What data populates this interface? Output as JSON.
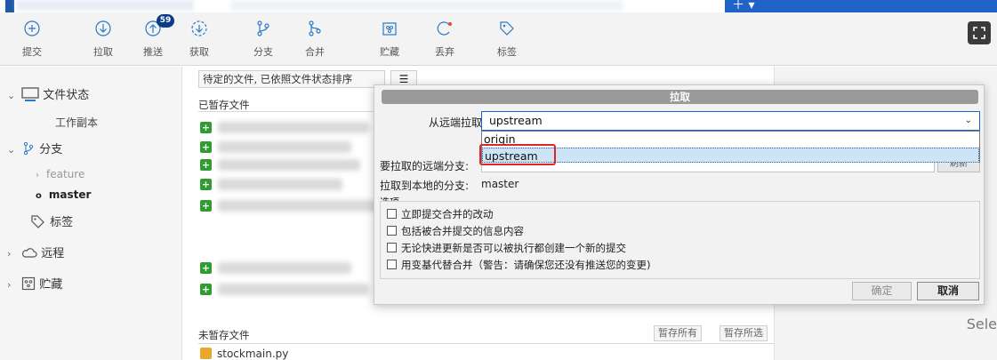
{
  "toolbar": {
    "commit": "提交",
    "pull": "拉取",
    "push": "推送",
    "push_badge": "59",
    "fetch": "获取",
    "branch": "分支",
    "merge": "合并",
    "stash": "贮藏",
    "discard": "丢弃",
    "tag": "标签"
  },
  "sidebar": {
    "file_status": "文件状态",
    "working_copy": "工作副本",
    "branches": "分支",
    "feature": "feature",
    "master": "master",
    "tags": "标签",
    "remotes": "远程",
    "stashes": "贮藏"
  },
  "main": {
    "sort_label": "待定的文件, 已依照文件状态排序",
    "view_label": "☰",
    "staged_title": "已暂存文件",
    "unstaged_title": "未暂存文件",
    "stage_all": "暂存所有",
    "stage_selected": "暂存所选",
    "file": "stockmain.py"
  },
  "right_panel": {
    "partial_text": "Sele"
  },
  "dialog": {
    "title": "拉取",
    "pull_from_label": "从远端拉取",
    "selected_remote": "upstream",
    "remote_options": [
      "origin",
      "upstream"
    ],
    "remote_branch_label": "要拉取的远端分支:",
    "local_branch_label": "拉取到本地的分支:",
    "local_branch": "master",
    "options_label": "选项",
    "opt1": "立即提交合并的改动",
    "opt2": "包括被合并提交的信息内容",
    "opt3": "无论快进更新是否可以被执行都创建一个新的提交",
    "opt4": "用变基代替合并（警告：请确保您还没有推送您的变更)",
    "ok": "确定",
    "cancel": "取消",
    "fetch_partial": "刷新"
  }
}
